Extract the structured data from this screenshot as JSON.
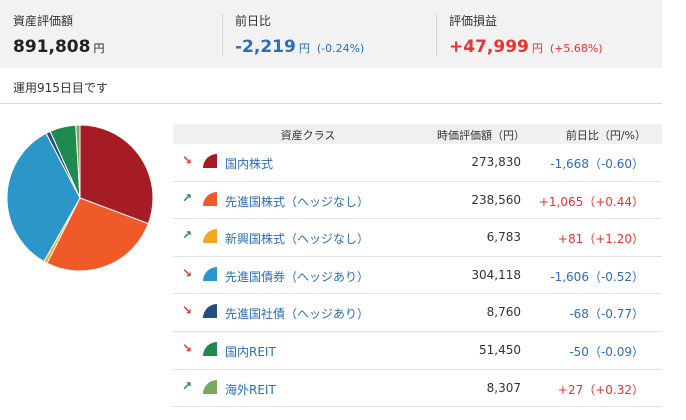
{
  "summary": {
    "valuation": {
      "label": "資産評価額",
      "value": "891,808",
      "unit": "円"
    },
    "day_change": {
      "label": "前日比",
      "value": "-2,219",
      "unit": "円",
      "pct": "(-0.24%)",
      "color": "#2a6ebb"
    },
    "pnl": {
      "label": "評価損益",
      "value": "+47,999",
      "unit": "円",
      "pct": "(+5.68%)",
      "color": "#e8332e"
    }
  },
  "days_text": "運用915日目です",
  "table": {
    "headers": {
      "asset_class": "資産クラス",
      "value": "時価評価額（円）",
      "diff": "前日比（円/%）"
    },
    "rows": [
      {
        "trend": "down",
        "color": "#a51c24",
        "name": "国内株式",
        "value": "273,830",
        "diff": "-1,668（-0.60）",
        "diff_color": "#2a6ebb"
      },
      {
        "trend": "up",
        "color": "#f05a28",
        "name": "先進国株式（ヘッジなし）",
        "value": "238,560",
        "diff": "+1,065（+0.44）",
        "diff_color": "#e8332e"
      },
      {
        "trend": "up",
        "color": "#f5a623",
        "name": "新興国株式（ヘッジなし）",
        "value": "6,783",
        "diff": "+81（+1.20）",
        "diff_color": "#e8332e"
      },
      {
        "trend": "down",
        "color": "#2b96c7",
        "name": "先進国債券（ヘッジあり）",
        "value": "304,118",
        "diff": "-1,606（-0.52）",
        "diff_color": "#2a6ebb"
      },
      {
        "trend": "down",
        "color": "#22507e",
        "name": "先進国社債（ヘッジあり）",
        "value": "8,760",
        "diff": "-68（-0.77）",
        "diff_color": "#2a6ebb"
      },
      {
        "trend": "down",
        "color": "#1e8a4e",
        "name": "国内REIT",
        "value": "51,450",
        "diff": "-50（-0.09）",
        "diff_color": "#2a6ebb"
      },
      {
        "trend": "up",
        "color": "#7aa95c",
        "name": "海外REIT",
        "value": "8,307",
        "diff": "+27（+0.32）",
        "diff_color": "#e8332e"
      }
    ]
  },
  "icons": {
    "down": "arrow-down-right-icon",
    "up": "arrow-up-right-icon"
  }
}
